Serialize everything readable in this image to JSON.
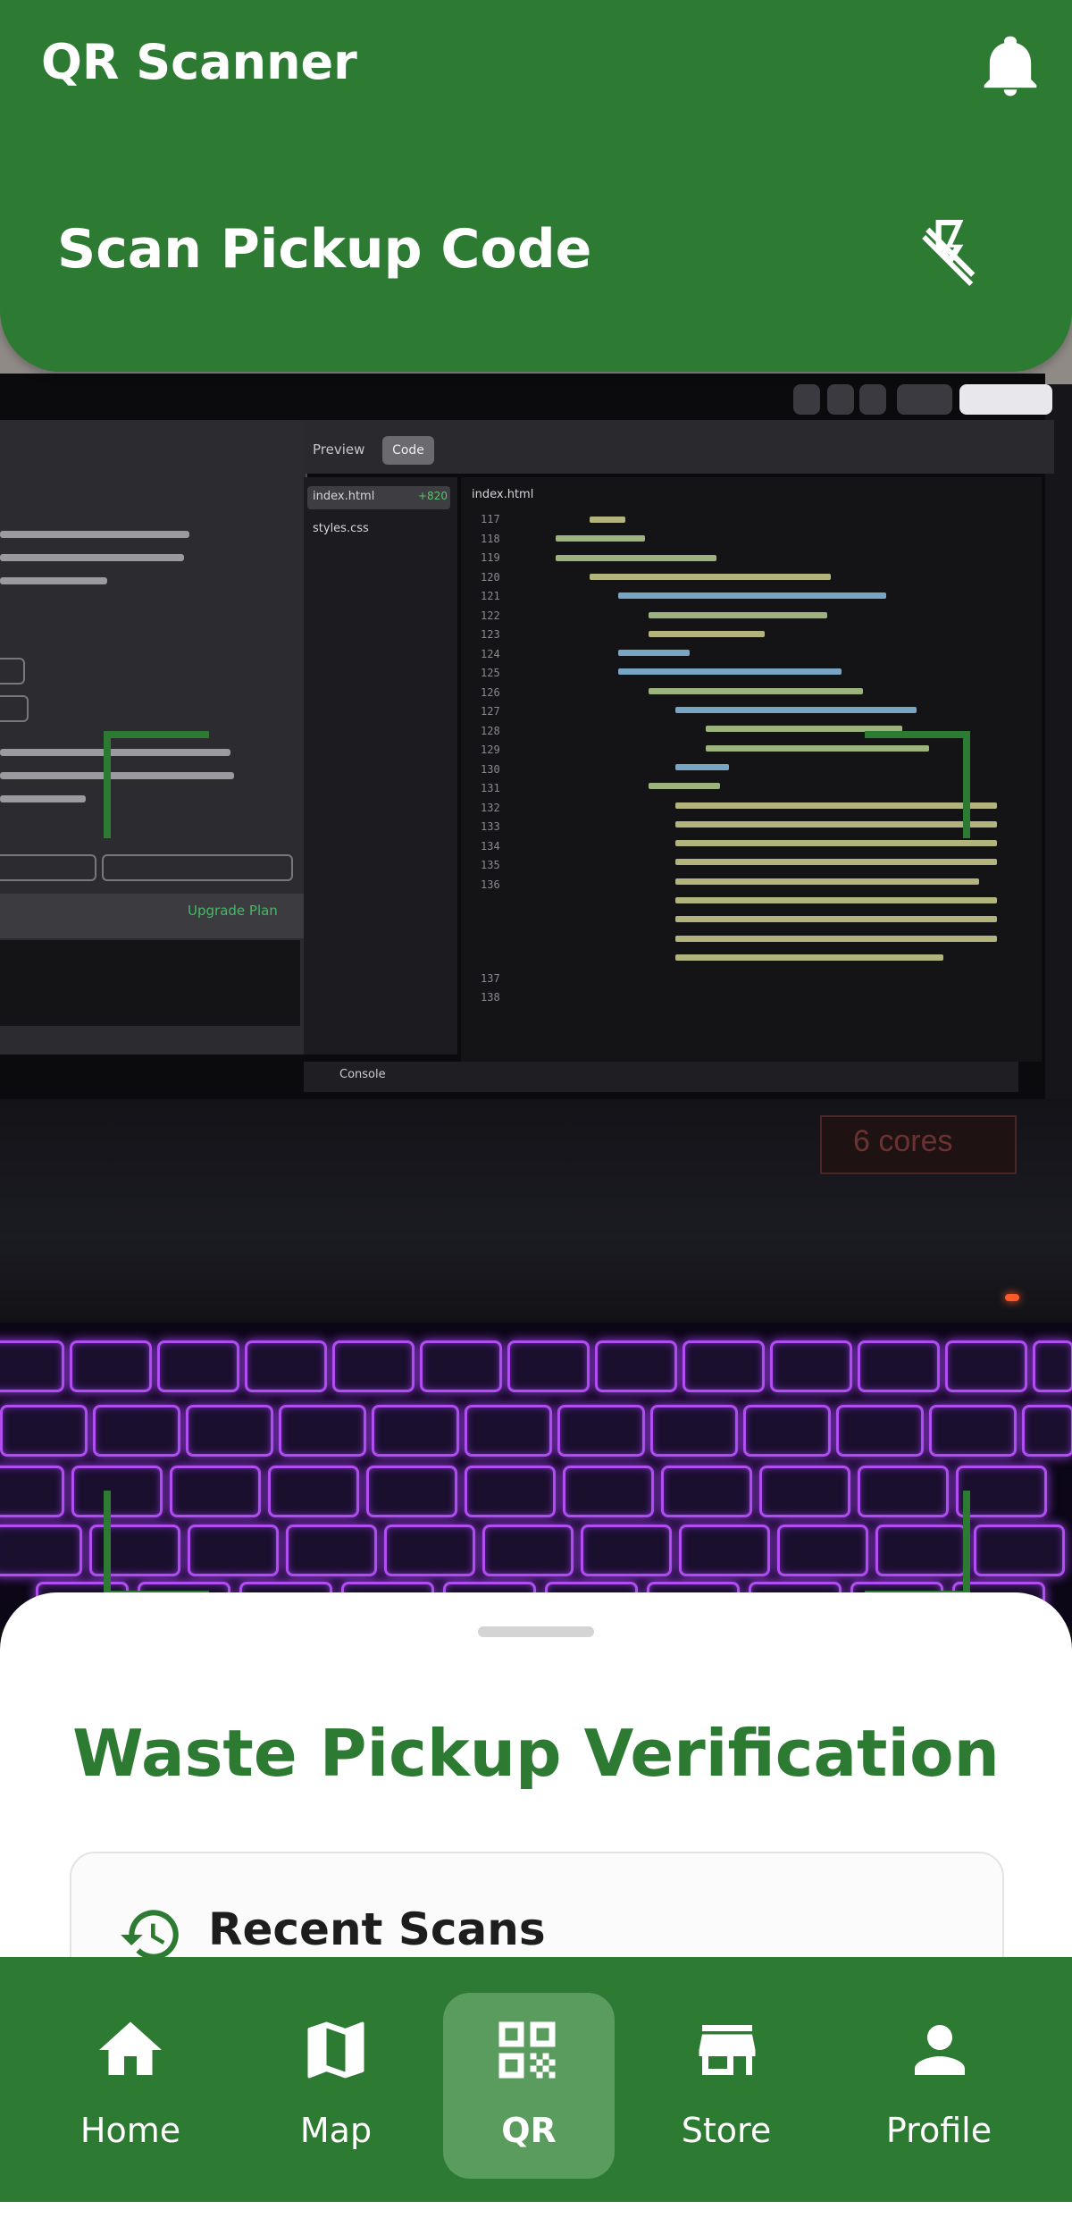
{
  "header": {
    "app_title": "QR Scanner",
    "scan_title": "Scan Pickup Code",
    "icons": [
      "notifications-bell-icon",
      "flash-off-icon"
    ]
  },
  "camera": {
    "editor": {
      "tab_preview": "Preview",
      "tab_code": "Code",
      "files": [
        "index.html",
        "styles.css"
      ],
      "open_file": "index.html",
      "file_badge": "+820",
      "gutter_numbers": [
        "117",
        "118",
        "119",
        "120",
        "121",
        "122",
        "123",
        "124",
        "125",
        "126",
        "127",
        "128",
        "129",
        "130",
        "131",
        "132",
        "133",
        "134",
        "135",
        "136",
        "137",
        "138"
      ],
      "console": "Console",
      "upgrade_label": "Upgrade Plan",
      "badge_text": "6 cores"
    }
  },
  "sheet": {
    "title": "Waste Pickup Verification",
    "recent_title": "Recent Scans"
  },
  "nav": {
    "items": [
      {
        "label": "Home",
        "icon": "home-icon",
        "active": false
      },
      {
        "label": "Map",
        "icon": "map-icon",
        "active": false
      },
      {
        "label": "QR",
        "icon": "qr-code-icon",
        "active": true
      },
      {
        "label": "Store",
        "icon": "store-icon",
        "active": false
      },
      {
        "label": "Profile",
        "icon": "profile-icon",
        "active": false
      }
    ]
  },
  "colors": {
    "primary": "#2d7a32",
    "nav_active": "#5a9b5e",
    "sheet_bg": "#ffffff"
  }
}
